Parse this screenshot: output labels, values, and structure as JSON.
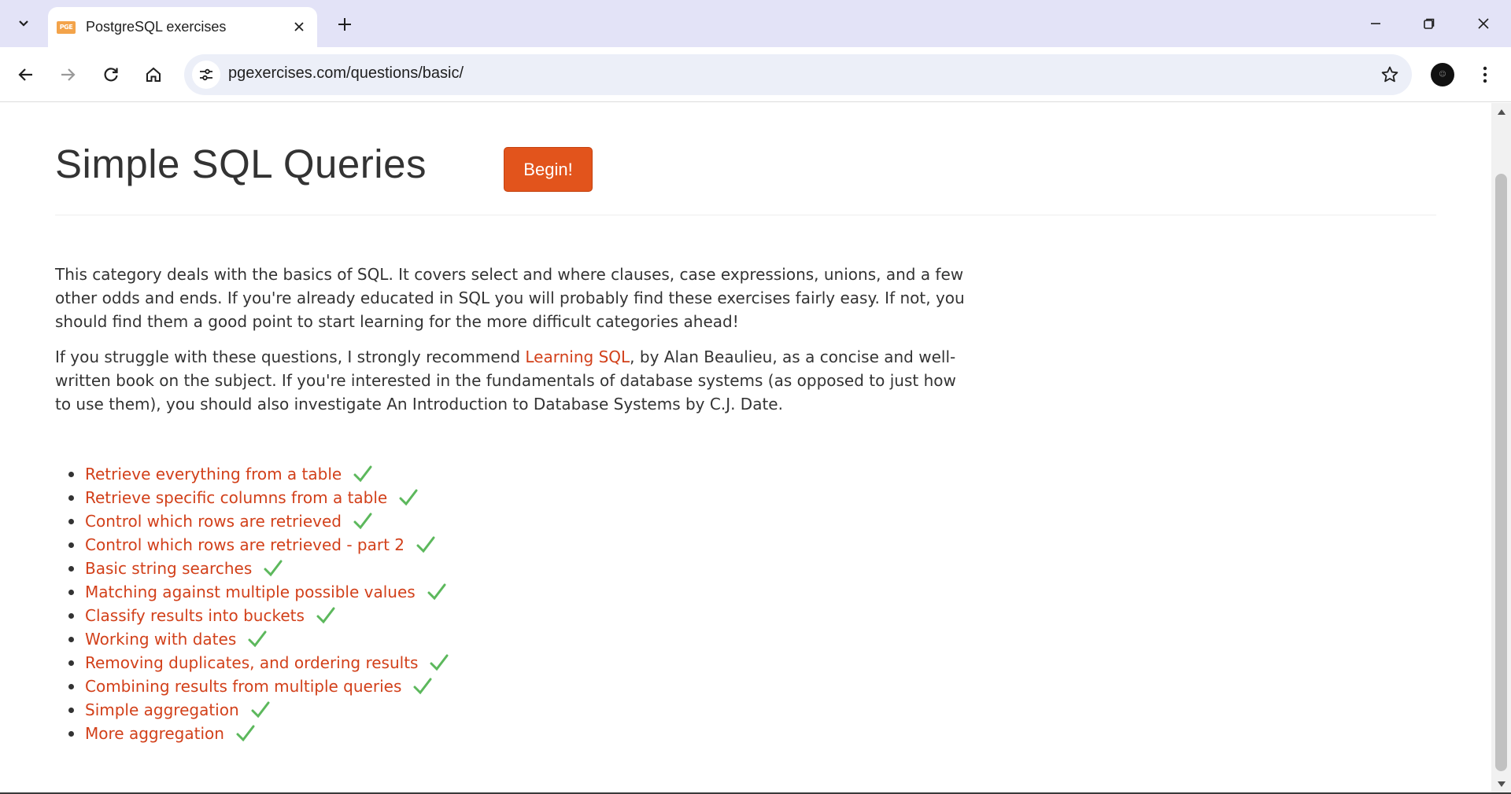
{
  "browser": {
    "tab_title": "PostgreSQL exercises",
    "favicon_text": "PGE",
    "url": "pgexercises.com/questions/basic/"
  },
  "page": {
    "title": "Simple SQL Queries",
    "begin_button": "Begin!",
    "paragraph1": "This category deals with the basics of SQL. It covers select and where clauses, case expressions, unions, and a few other odds and ends. If you're already educated in SQL you will probably find these exercises fairly easy. If not, you should find them a good point to start learning for the more difficult categories ahead!",
    "paragraph2_before": "If you struggle with these questions, I strongly recommend ",
    "paragraph2_link": "Learning SQL",
    "paragraph2_after": ", by Alan Beaulieu, as a concise and well-written book on the subject. If you're interested in the fundamentals of database systems (as opposed to just how to use them), you should also investigate An Introduction to Database Systems by C.J. Date.",
    "questions": [
      "Retrieve everything from a table",
      "Retrieve specific columns from a table",
      "Control which rows are retrieved",
      "Control which rows are retrieved - part 2",
      "Basic string searches",
      "Matching against multiple possible values",
      "Classify results into buckets",
      "Working with dates",
      "Removing duplicates, and ordering results",
      "Combining results from multiple queries",
      "Simple aggregation",
      "More aggregation"
    ]
  },
  "colors": {
    "accent": "#d2401a",
    "button": "#e2541c",
    "check": "#5cb85c"
  }
}
